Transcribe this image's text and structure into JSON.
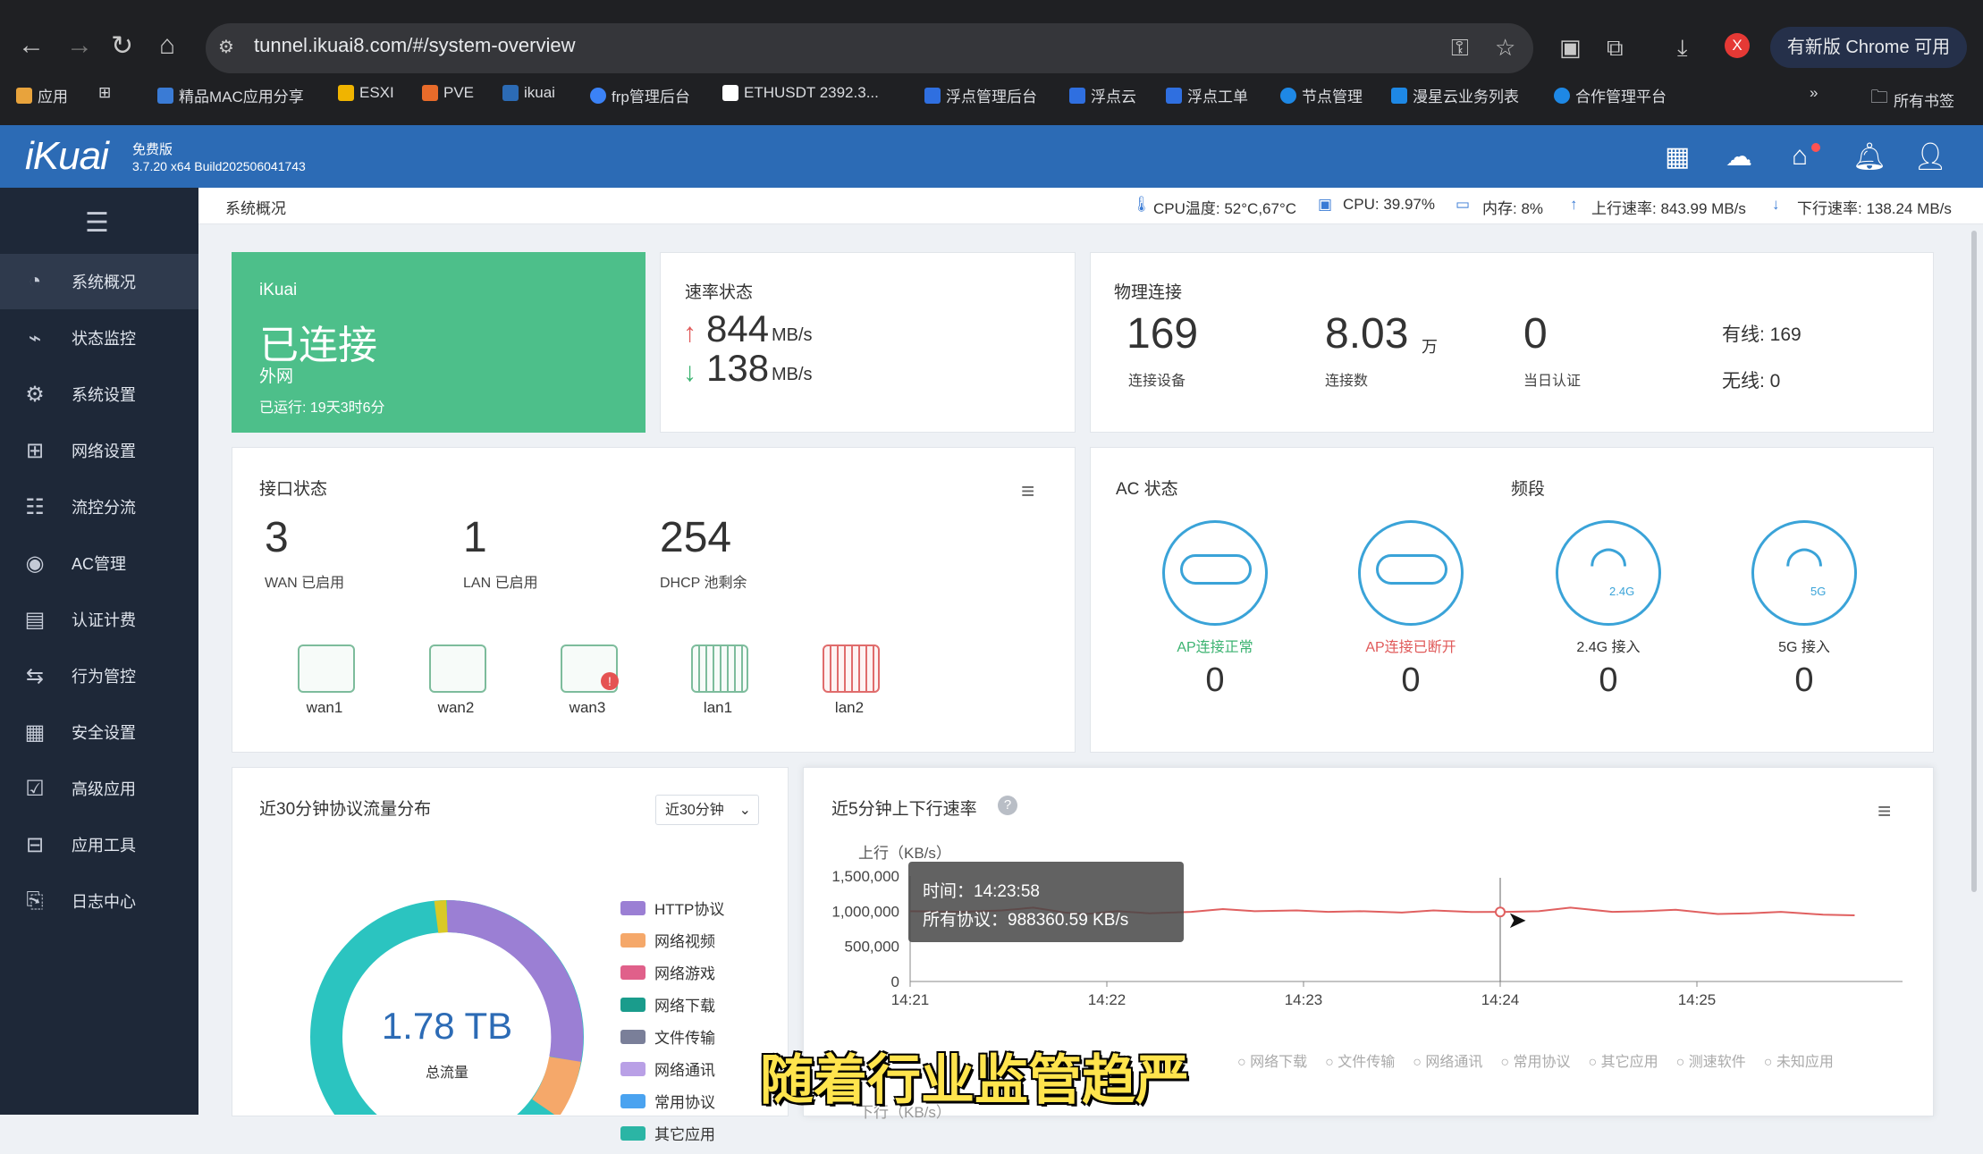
{
  "browser": {
    "url": "tunnel.ikuai8.com/#/system-overview",
    "update_button": "有新版 Chrome 可用",
    "profile_initial": "X",
    "bookmarks": [
      "应用",
      "精品MAC应用分享",
      "ESXI",
      "PVE",
      "ikuai",
      "frp管理后台",
      "ETHUSDT 2392.3...",
      "浮点管理后台",
      "浮点云",
      "浮点工单",
      "节点管理",
      "漫星云业务列表",
      "合作管理平台"
    ],
    "all_bookmarks": "所有书签"
  },
  "header": {
    "logo": "iKuai",
    "edition": "免费版",
    "version": "3.7.20 x64 Build202506041743"
  },
  "sidebar": {
    "items": [
      {
        "label": "系统概况",
        "icon": "dashboard-icon"
      },
      {
        "label": "状态监控",
        "icon": "monitor-icon"
      },
      {
        "label": "系统设置",
        "icon": "gear-icon"
      },
      {
        "label": "网络设置",
        "icon": "network-icon"
      },
      {
        "label": "流控分流",
        "icon": "sliders-icon"
      },
      {
        "label": "AC管理",
        "icon": "wifi-icon"
      },
      {
        "label": "认证计费",
        "icon": "id-card-icon"
      },
      {
        "label": "行为管控",
        "icon": "arrows-icon"
      },
      {
        "label": "安全设置",
        "icon": "shield-icon"
      },
      {
        "label": "高级应用",
        "icon": "check-box-icon"
      },
      {
        "label": "应用工具",
        "icon": "tools-icon"
      },
      {
        "label": "日志中心",
        "icon": "document-icon"
      }
    ]
  },
  "status": {
    "breadcrumb": "系统概况",
    "cpu_temp": "CPU温度: 52°C,67°C",
    "cpu": "CPU: 39.97%",
    "memory": "内存: 8%",
    "upload": "上行速率: 843.99 MB/s",
    "download": "下行速率: 138.24 MB/s"
  },
  "connection": {
    "brand": "iKuai",
    "state": "已连接",
    "type": "外网",
    "uptime": "已运行: 19天3时6分",
    "color": "#4dbf8a"
  },
  "rate": {
    "title": "速率状态",
    "up_value": "844",
    "up_unit": "MB/s",
    "down_value": "138",
    "down_unit": "MB/s"
  },
  "physical": {
    "title": "物理连接",
    "devices_value": "169",
    "devices_label": "连接设备",
    "conns_value": "8.03",
    "conns_unit": "万",
    "conns_label": "连接数",
    "auth_value": "0",
    "auth_label": "当日认证",
    "wired": "有线: 169",
    "wireless": "无线: 0"
  },
  "interfaces": {
    "title": "接口状态",
    "wan_value": "3",
    "wan_label": "WAN 已启用",
    "lan_value": "1",
    "lan_label": "LAN 已启用",
    "dhcp_value": "254",
    "dhcp_label": "DHCP 池剩余",
    "ports": [
      "wan1",
      "wan2",
      "wan3",
      "lan1",
      "lan2"
    ]
  },
  "ac": {
    "title": "AC 状态",
    "band_title": "频段",
    "items": [
      {
        "label": "AP连接正常",
        "value": "0",
        "color": "#3cb371"
      },
      {
        "label": "AP连接已断开",
        "value": "0",
        "color": "#e05a5a"
      },
      {
        "label": "2.4G 接入",
        "value": "0",
        "color": "#333333"
      },
      {
        "label": "5G 接入",
        "value": "0",
        "color": "#333333"
      }
    ],
    "band_24": "2.4G",
    "band_5": "5G"
  },
  "protocol": {
    "title": "近30分钟协议流量分布",
    "range": "近30分钟",
    "total_value": "1.78 TB",
    "total_label": "总流量",
    "legend": [
      {
        "label": "HTTP协议",
        "color": "#9b7fd4"
      },
      {
        "label": "网络视频",
        "color": "#f5a86a"
      },
      {
        "label": "网络游戏",
        "color": "#e0608a"
      },
      {
        "label": "网络下载",
        "color": "#1a9c8c"
      },
      {
        "label": "文件传输",
        "color": "#7a7f99"
      },
      {
        "label": "网络通讯",
        "color": "#b9a0e6"
      },
      {
        "label": "常用协议",
        "color": "#4aa3f0"
      },
      {
        "label": "其它应用",
        "color": "#2bb5a5"
      }
    ]
  },
  "rate_chart": {
    "title": "近5分钟上下行速率",
    "up_label": "上行（KB/s）",
    "down_label": "下行（KB/s）",
    "tooltip_time": "时间：14:23:58",
    "tooltip_value": "所有协议：988360.59 KB/s",
    "bottom_legend": [
      "网络下载",
      "文件传输",
      "网络通讯",
      "常用协议",
      "其它应用",
      "测速软件",
      "未知应用"
    ]
  },
  "chart_data": {
    "type": "line",
    "ylabel": "上行（KB/s）",
    "ylim": [
      0,
      1500000
    ],
    "yticks": [
      "1,500,000",
      "1,000,000",
      "500,000",
      "0"
    ],
    "xticks": [
      "14:21",
      "14:22",
      "14:23",
      "14:24",
      "14:25"
    ],
    "series": [
      {
        "color": "#e06060",
        "x": [
          14.333,
          14.38,
          14.42,
          14.45,
          14.48,
          14.5,
          14.53,
          14.56,
          14.6,
          14.63,
          14.66,
          14.7,
          14.73,
          14.76,
          14.8,
          14.83,
          14.866,
          14.9,
          14.93,
          14.96,
          15.0,
          15.03,
          15.06,
          15.1,
          15.13,
          15.16,
          15.2,
          15.23
        ],
        "values": [
          1000000,
          990000,
          1010000,
          1050000,
          980000,
          960000,
          1000000,
          970000,
          990000,
          1030000,
          1000000,
          1010000,
          990000,
          1000000,
          980000,
          1010000,
          988360,
          990000,
          1000000,
          1050000,
          990000,
          1000000,
          1020000,
          960000,
          970000,
          990000,
          950000,
          940000
        ]
      }
    ]
  },
  "overlay_caption": "随着行业监管趋严"
}
